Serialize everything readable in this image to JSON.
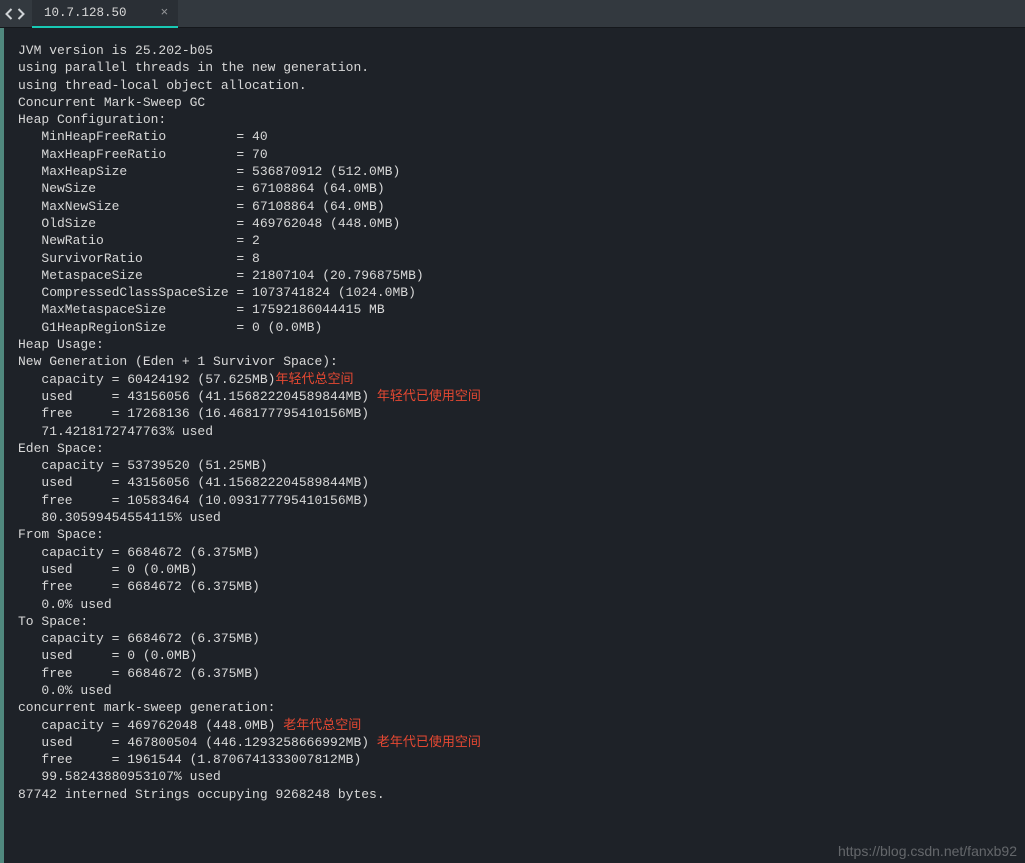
{
  "tab": {
    "title": "10.7.128.50",
    "close": "×"
  },
  "lines": [
    {
      "t": "JVM version is 25.202-b05"
    },
    {
      "t": ""
    },
    {
      "t": "using parallel threads in the new generation."
    },
    {
      "t": "using thread-local object allocation."
    },
    {
      "t": "Concurrent Mark-Sweep GC"
    },
    {
      "t": ""
    },
    {
      "t": "Heap Configuration:"
    },
    {
      "t": "   MinHeapFreeRatio         = 40"
    },
    {
      "t": "   MaxHeapFreeRatio         = 70"
    },
    {
      "t": "   MaxHeapSize              = 536870912 (512.0MB)"
    },
    {
      "t": "   NewSize                  = 67108864 (64.0MB)"
    },
    {
      "t": "   MaxNewSize               = 67108864 (64.0MB)"
    },
    {
      "t": "   OldSize                  = 469762048 (448.0MB)"
    },
    {
      "t": "   NewRatio                 = 2"
    },
    {
      "t": "   SurvivorRatio            = 8"
    },
    {
      "t": "   MetaspaceSize            = 21807104 (20.796875MB)"
    },
    {
      "t": "   CompressedClassSpaceSize = 1073741824 (1024.0MB)"
    },
    {
      "t": "   MaxMetaspaceSize         = 17592186044415 MB"
    },
    {
      "t": "   G1HeapRegionSize         = 0 (0.0MB)"
    },
    {
      "t": ""
    },
    {
      "t": "Heap Usage:"
    },
    {
      "t": "New Generation (Eden + 1 Survivor Space):"
    },
    {
      "t": "   capacity = 60424192 (57.625MB)",
      "a": "年轻代总空间"
    },
    {
      "t": "   used     = 43156056 (41.156822204589844MB) ",
      "a": "年轻代已使用空间"
    },
    {
      "t": "   free     = 17268136 (16.468177795410156MB)"
    },
    {
      "t": "   71.4218172747763% used"
    },
    {
      "t": "Eden Space:"
    },
    {
      "t": "   capacity = 53739520 (51.25MB)"
    },
    {
      "t": "   used     = 43156056 (41.156822204589844MB)"
    },
    {
      "t": "   free     = 10583464 (10.093177795410156MB)"
    },
    {
      "t": "   80.30599454554115% used"
    },
    {
      "t": "From Space:"
    },
    {
      "t": "   capacity = 6684672 (6.375MB)"
    },
    {
      "t": "   used     = 0 (0.0MB)"
    },
    {
      "t": "   free     = 6684672 (6.375MB)"
    },
    {
      "t": "   0.0% used"
    },
    {
      "t": "To Space:"
    },
    {
      "t": "   capacity = 6684672 (6.375MB)"
    },
    {
      "t": "   used     = 0 (0.0MB)"
    },
    {
      "t": "   free     = 6684672 (6.375MB)"
    },
    {
      "t": "   0.0% used"
    },
    {
      "t": "concurrent mark-sweep generation:"
    },
    {
      "t": "   capacity = 469762048 (448.0MB) ",
      "a": "老年代总空间"
    },
    {
      "t": "   used     = 467800504 (446.1293258666992MB) ",
      "a": "老年代已使用空间"
    },
    {
      "t": "   free     = 1961544 (1.8706741333007812MB)"
    },
    {
      "t": "   99.58243880953107% used"
    },
    {
      "t": ""
    },
    {
      "t": "87742 interned Strings occupying 9268248 bytes."
    }
  ],
  "watermark": "https://blog.csdn.net/fanxb92"
}
